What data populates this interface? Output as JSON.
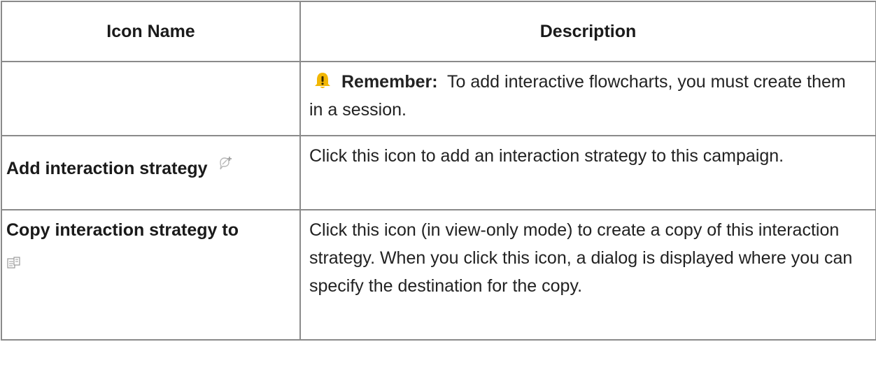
{
  "table": {
    "headers": {
      "icon_name": "Icon Name",
      "description": "Description"
    },
    "rows": [
      {
        "icon_name": "",
        "note_label": "Remember:",
        "description": "To add interactive flowcharts, you must create them in a session."
      },
      {
        "icon_name": "Add interaction strategy",
        "icon": "add-interaction-strategy-icon",
        "description": "Click this icon to add an interaction strategy to this campaign."
      },
      {
        "icon_name": "Copy interaction strategy to",
        "icon": "copy-icon",
        "description": "Click this icon (in view-only mode) to create a copy of this interaction strategy. When you click this icon, a dialog is displayed where you can specify the destination for the copy."
      }
    ]
  },
  "colors": {
    "border": "#8a8a8a",
    "note_icon": "#f2b705",
    "text": "#222222"
  }
}
